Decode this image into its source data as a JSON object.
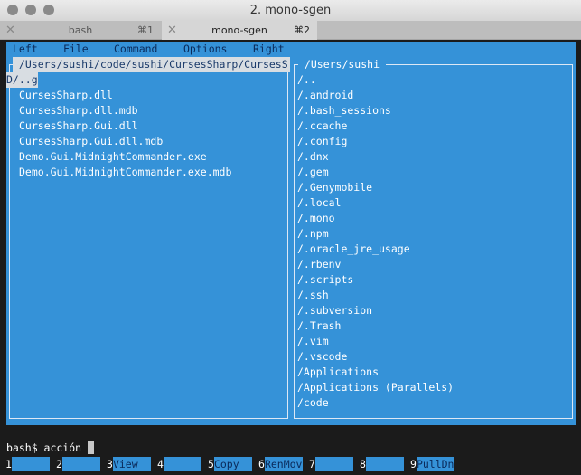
{
  "window": {
    "title": "2. mono-sgen"
  },
  "tabs": [
    {
      "label": "bash",
      "shortcut": "⌘1"
    },
    {
      "label": "mono-sgen",
      "shortcut": "⌘2",
      "active": true
    }
  ],
  "menu": [
    "Left",
    "File",
    "Command",
    "Options",
    "Right"
  ],
  "left_panel": {
    "path": " /Users/sushi/code/sushi/CursesSharp/CursesS",
    "selected": "D/..g",
    "files": [
      "CursesSharp.dll",
      "CursesSharp.dll.mdb",
      "CursesSharp.Gui.dll",
      "CursesSharp.Gui.dll.mdb",
      "Demo.Gui.MidnightCommander.exe",
      "Demo.Gui.MidnightCommander.exe.mdb"
    ]
  },
  "right_panel": {
    "path": " /Users/sushi ",
    "files": [
      "/..",
      "/.android",
      "/.bash_sessions",
      "/.ccache",
      "/.config",
      "/.dnx",
      "/.gem",
      "/.Genymobile",
      "/.local",
      "/.mono",
      "/.npm",
      "/.oracle_jre_usage",
      "/.rbenv",
      "/.scripts",
      "/.ssh",
      "/.subversion",
      "/.Trash",
      "/.vim",
      "/.vscode",
      "/Applications",
      "/Applications (Parallels)",
      "/code"
    ]
  },
  "prompt": "bash$ acción ",
  "fkeys": [
    {
      "n": "1",
      "label": ""
    },
    {
      "n": "2",
      "label": ""
    },
    {
      "n": "3",
      "label": "View"
    },
    {
      "n": "4",
      "label": ""
    },
    {
      "n": "5",
      "label": "Copy"
    },
    {
      "n": "6",
      "label": "RenMov"
    },
    {
      "n": "7",
      "label": ""
    },
    {
      "n": "8",
      "label": ""
    },
    {
      "n": "9",
      "label": "PullDn"
    }
  ],
  "colors": {
    "panel_bg": "#3592d8",
    "terminal_bg": "#1b1b1b"
  }
}
